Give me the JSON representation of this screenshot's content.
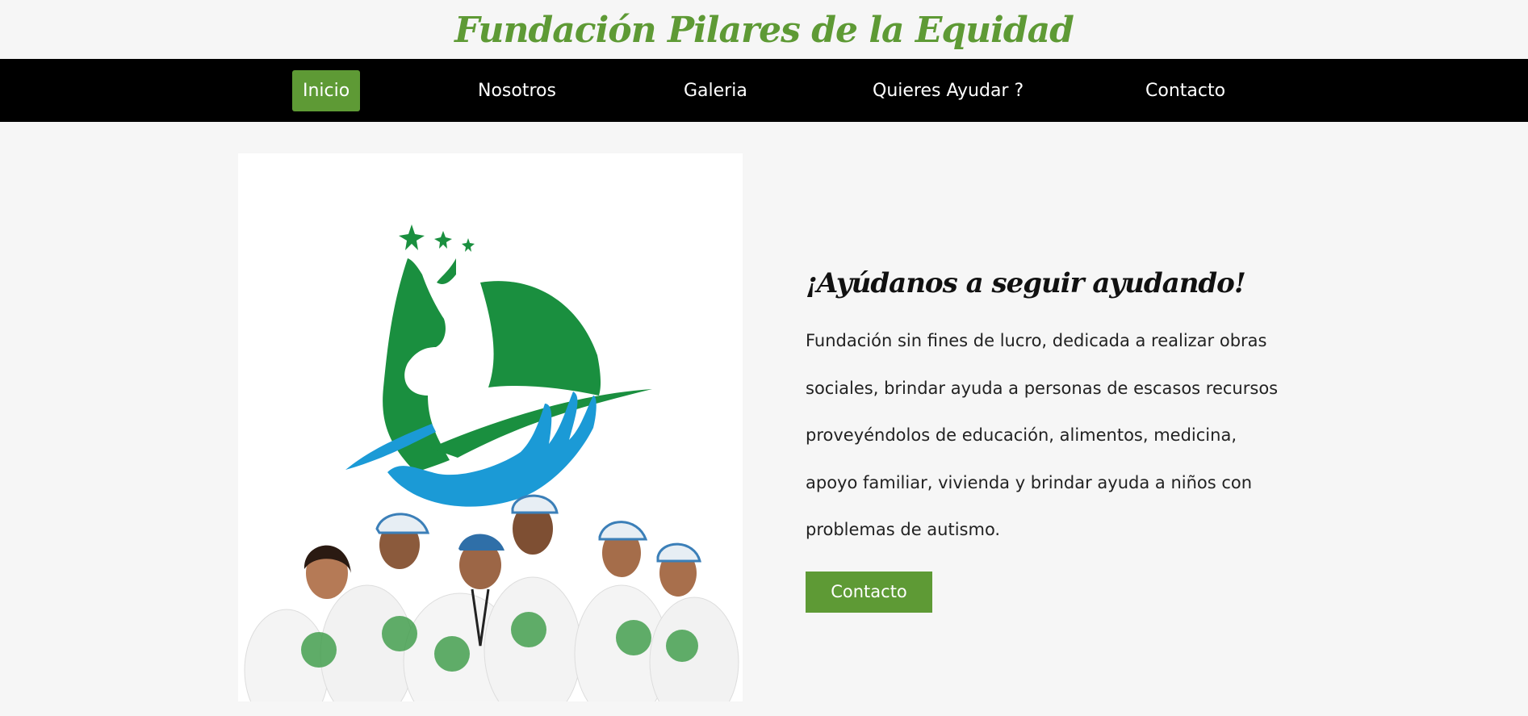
{
  "header": {
    "title": "Fundación Pilares de la Equidad"
  },
  "nav": {
    "items": [
      {
        "label": "Inicio",
        "active": true
      },
      {
        "label": "Nosotros"
      },
      {
        "label": "Galeria"
      },
      {
        "label": "Quieres Ayudar ?"
      },
      {
        "label": "Contacto"
      }
    ]
  },
  "hero": {
    "heading": "¡Ayúdanos a seguir ayudando!",
    "description": "Fundación sin fines de lucro, dedicada a realizar obras sociales, brindar ayuda a personas de escasos recursos proveyéndolos de educación, alimentos, medicina, apoyo familiar, vivienda y brindar ayuda a niños con problemas de autismo.",
    "button_label": "Contacto"
  },
  "colors": {
    "brand_green": "#5e9a35",
    "logo_green": "#1a8f3f",
    "logo_blue": "#1b9ad6",
    "nav_bg": "#000000"
  }
}
